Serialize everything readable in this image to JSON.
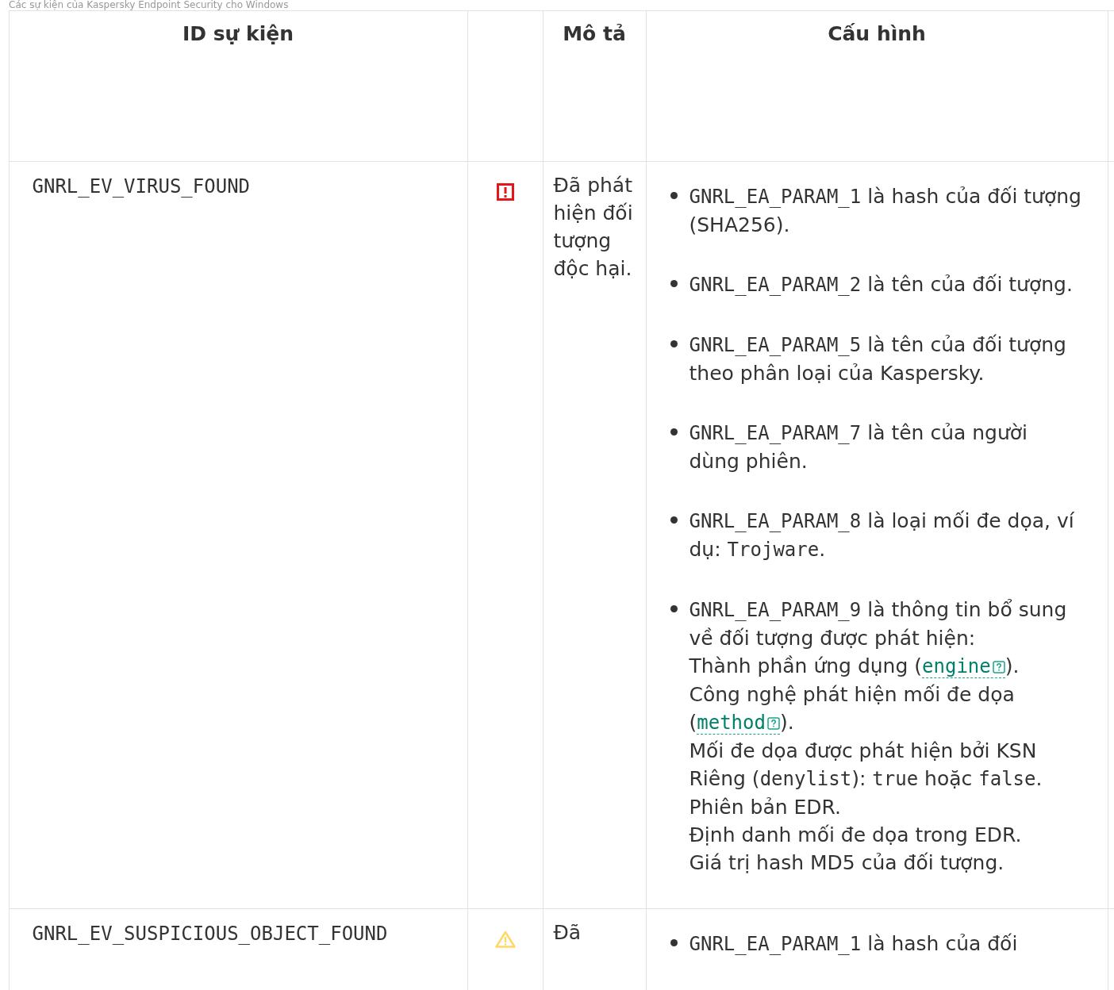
{
  "caption": "Các sự kiện của Kaspersky Endpoint Security cho Windows",
  "table": {
    "columns": [
      "ID sự kiện",
      "",
      "Mô tả",
      "Cấu hình"
    ],
    "rows": [
      {
        "event_id": "GNRL_EV_VIRUS_FOUND",
        "kind": "critical",
        "description": "Đã phát hiện đối tượng độc hại.",
        "params": [
          {
            "lines": [
              [
                {
                  "kind": "code",
                  "text": "GNRL_EA_PARAM_1"
                },
                {
                  "kind": "text",
                  "text": " là hash của đối tượng (SHA256)."
                }
              ]
            ]
          },
          {
            "lines": [
              [
                {
                  "kind": "code",
                  "text": "GNRL_EA_PARAM_2"
                },
                {
                  "kind": "text",
                  "text": " là tên của đối tượng."
                }
              ]
            ]
          },
          {
            "lines": [
              [
                {
                  "kind": "code",
                  "text": "GNRL_EA_PARAM_5"
                },
                {
                  "kind": "text",
                  "text": " là tên của đối tượng theo phân loại của Kaspersky."
                }
              ]
            ]
          },
          {
            "lines": [
              [
                {
                  "kind": "code",
                  "text": "GNRL_EA_PARAM_7"
                },
                {
                  "kind": "text",
                  "text": " là tên của người dùng phiên."
                }
              ]
            ]
          },
          {
            "lines": [
              [
                {
                  "kind": "code",
                  "text": "GNRL_EA_PARAM_8"
                },
                {
                  "kind": "text",
                  "text": " là loại mối đe dọa, ví dụ: "
                },
                {
                  "kind": "code",
                  "text": "Trojware"
                },
                {
                  "kind": "text",
                  "text": "."
                }
              ]
            ]
          },
          {
            "lines": [
              [
                {
                  "kind": "code",
                  "text": "GNRL_EA_PARAM_9"
                },
                {
                  "kind": "text",
                  "text": " là thông tin bổ sung về đối tượng được phát hiện:"
                }
              ],
              [
                {
                  "kind": "text",
                  "text": "Thành phần ứng dụng ("
                },
                {
                  "kind": "link",
                  "text": "engine"
                },
                {
                  "kind": "text",
                  "text": ")."
                }
              ],
              [
                {
                  "kind": "text",
                  "text": "Công nghệ phát hiện mối đe dọa ("
                },
                {
                  "kind": "link",
                  "text": "method"
                },
                {
                  "kind": "text",
                  "text": ")."
                }
              ],
              [
                {
                  "kind": "text",
                  "text": "Mối đe dọa được phát hiện bởi KSN Riêng ("
                },
                {
                  "kind": "code",
                  "text": "denylist"
                },
                {
                  "kind": "text",
                  "text": "): "
                },
                {
                  "kind": "code",
                  "text": "true"
                },
                {
                  "kind": "text",
                  "text": " hoặc "
                },
                {
                  "kind": "code",
                  "text": "false"
                },
                {
                  "kind": "text",
                  "text": "."
                }
              ],
              [
                {
                  "kind": "text",
                  "text": "Phiên bản EDR."
                }
              ],
              [
                {
                  "kind": "text",
                  "text": "Định danh mối đe dọa trong EDR."
                }
              ],
              [
                {
                  "kind": "text",
                  "text": "Giá trị hash MD5 của đối tượng."
                }
              ]
            ]
          }
        ]
      },
      {
        "event_id": "GNRL_EV_SUSPICIOUS_OBJECT_FOUND",
        "kind": "warning",
        "description": "Đã",
        "params": [
          {
            "lines": [
              [
                {
                  "kind": "code",
                  "text": "GNRL_EA_PARAM_1"
                },
                {
                  "kind": "text",
                  "text": " là hash của đối"
                }
              ]
            ]
          }
        ]
      }
    ]
  }
}
